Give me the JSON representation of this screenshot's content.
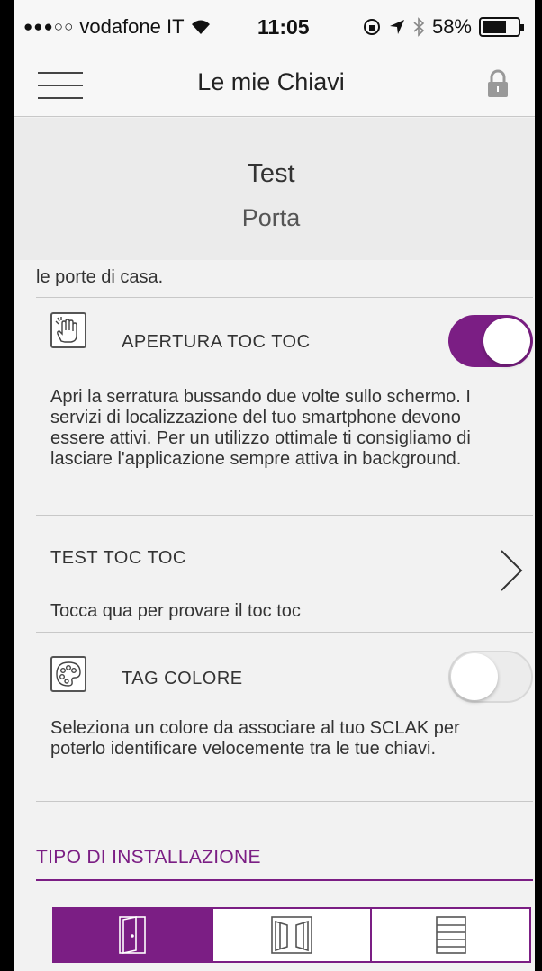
{
  "status_bar": {
    "signal_dots": "●●●○○",
    "carrier": "vodafone IT",
    "time": "11:05",
    "battery": "58%",
    "battery_level": 0.58
  },
  "nav": {
    "title": "Le mie Chiavi",
    "menu_icon": "hamburger-icon",
    "lock_icon": "lock-icon"
  },
  "header": {
    "title": "Test",
    "subtitle": "Porta"
  },
  "content": {
    "cut_text": "le porte di casa.",
    "toc_toc": {
      "label": "APERTURA TOC TOC",
      "icon": "knock-hand-icon",
      "enabled": true,
      "description": "Apri la serratura bussando due volte sullo schermo. I servizi di localizzazione del tuo smartphone devono essere attivi. Per un utilizzo ottimale ti consigliamo di lasciare l'applicazione sempre attiva in background."
    },
    "test_toc": {
      "label": "TEST TOC TOC",
      "description": "Tocca qua per provare il toc toc"
    },
    "tag_colore": {
      "label": "TAG COLORE",
      "icon": "palette-icon",
      "enabled": false,
      "description": "Seleziona un colore da associare al tuo SCLAK per poterlo identificare velocemente tra le tue chiavi."
    },
    "installation": {
      "section_title": "TIPO DI INSTALLAZIONE",
      "options": [
        {
          "icon": "door-icon",
          "selected": true
        },
        {
          "icon": "gate-icon",
          "selected": false
        },
        {
          "icon": "garage-door-icon",
          "selected": false
        }
      ]
    }
  },
  "colors": {
    "accent": "#7b1e84",
    "background": "#f2f2f2",
    "header_bg": "#ebebeb"
  }
}
